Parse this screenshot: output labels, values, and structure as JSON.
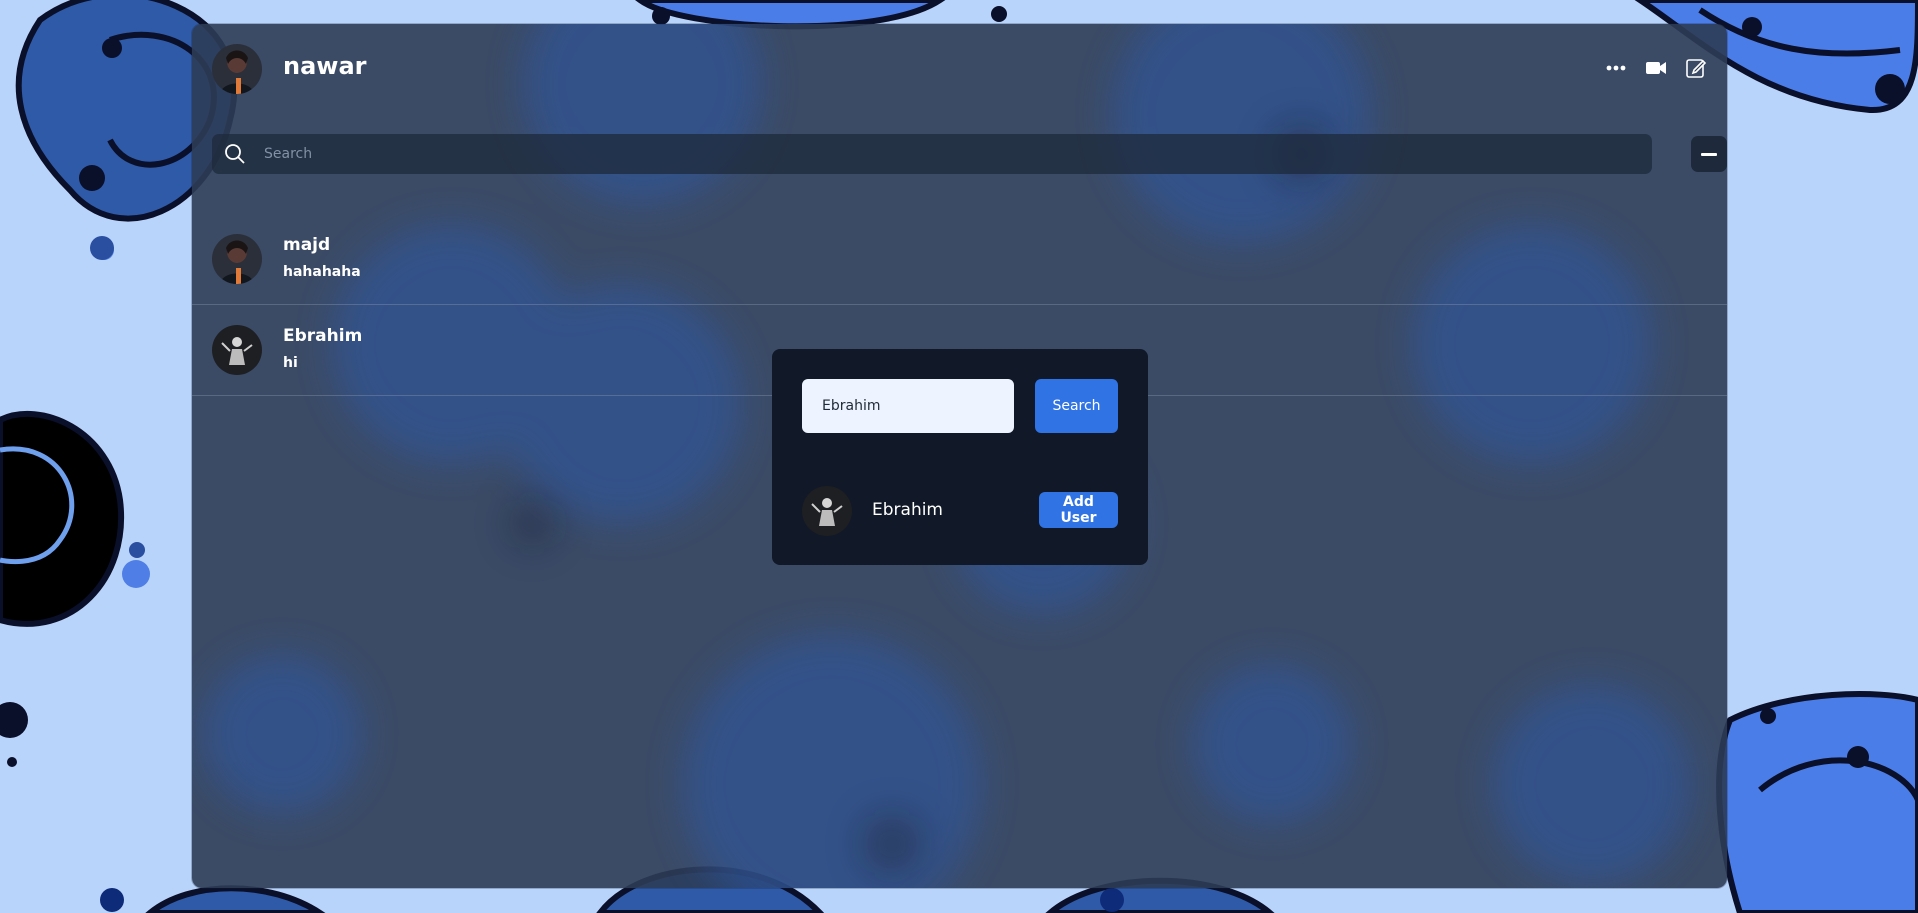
{
  "header": {
    "username": "nawar",
    "avatar_icon": "user-avatar-dark-hair",
    "actions": [
      {
        "name": "more-options-icon",
        "glyph": "•••"
      },
      {
        "name": "video-call-icon"
      },
      {
        "name": "edit-compose-icon"
      }
    ]
  },
  "search": {
    "placeholder": "Search",
    "value": ""
  },
  "chats": [
    {
      "name": "majd",
      "last_message": "hahahaha",
      "avatar": "user-avatar-red-tint"
    },
    {
      "name": "Ebrahim",
      "last_message": "hi",
      "avatar": "user-avatar-dark-figure"
    }
  ],
  "add_user_modal": {
    "input_value": "Ebrahim",
    "search_button_label": "Search",
    "result": {
      "name": "Ebrahim",
      "add_button_label": "Add User"
    }
  },
  "colors": {
    "page_background": "#b9d4fb",
    "panel": "#2e3c55",
    "modal": "#111827",
    "accent_button": "#2f73e5",
    "input_background": "#eef4ff"
  }
}
